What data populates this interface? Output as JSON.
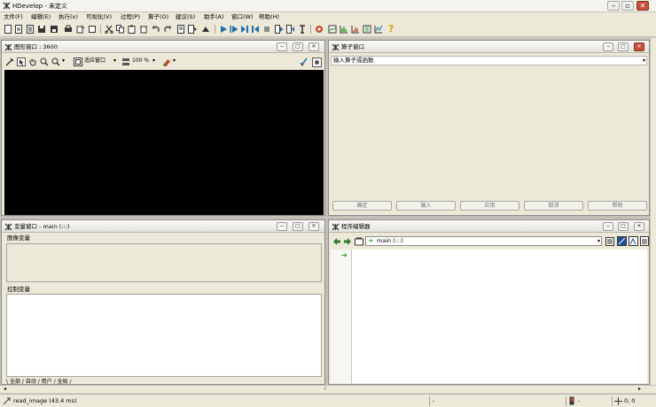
{
  "window": {
    "title": "HDevelop - 未定义"
  },
  "menu": [
    "文件(F)",
    "编辑(E)",
    "执行(x)",
    "可视化(V)",
    "过程(P)",
    "算子(O)",
    "建议(S)",
    "助手(A)",
    "窗口(W)",
    "帮助(H)"
  ],
  "graphics_window": {
    "title": "图形窗口 : 3600",
    "fit_label": "适应窗口",
    "zoom": "100 %"
  },
  "operator_window": {
    "title": "算子窗口",
    "input_placeholder": "输入算子或函数",
    "buttons": [
      "确定",
      "输入",
      "应用",
      "取消",
      "帮助"
    ]
  },
  "variable_window": {
    "title": "变量窗口 - main (:::)",
    "iconic_label": "图像变量",
    "control_label": "控制变量",
    "tabs": [
      "全部",
      "自动",
      "用户",
      "全局"
    ]
  },
  "program_editor": {
    "title": "程序编辑器",
    "procedure": "main (:::)"
  },
  "status": {
    "message": "read_image (43.4 ms)",
    "middle": "-",
    "right_a": "-",
    "coords": "0, 0"
  },
  "colors": {
    "graphics_bg": "#000000",
    "close_button": "#c8503c",
    "pc_arrow": "#2e9a2e"
  }
}
